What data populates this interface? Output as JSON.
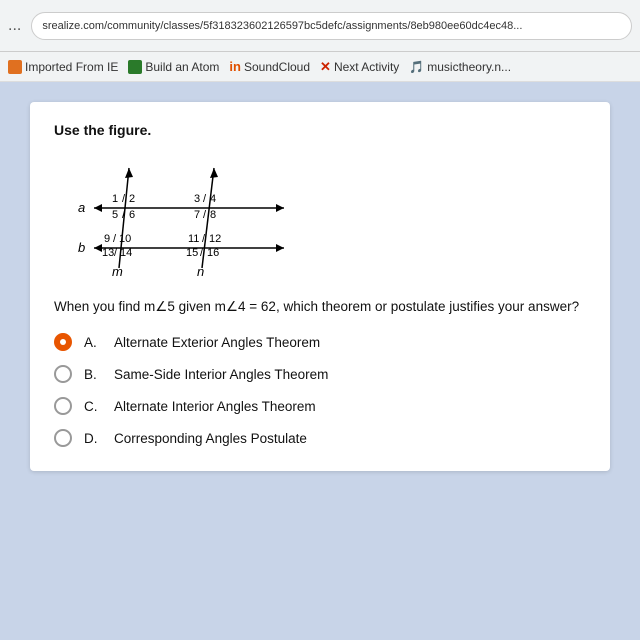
{
  "browser": {
    "url": "srealize.com/community/classes/5f318323602126597bc5defc/assignments/8eb980ee60dc4ec48...",
    "dots": "...",
    "bookmarks": [
      {
        "label": "Imported From IE",
        "icon": "orange-square"
      },
      {
        "label": "Build an Atom",
        "icon": "green-square"
      },
      {
        "label": "SoundCloud",
        "icon": "soundcloud"
      },
      {
        "label": "Next Activity",
        "icon": "x-red"
      },
      {
        "label": "musictheory.n...",
        "icon": "music"
      }
    ]
  },
  "card": {
    "figure_label": "Use the figure.",
    "question": "When you find m∠5 given m∠4 = 62, which theorem or postulate justifies your answer?",
    "options": [
      {
        "letter": "A.",
        "text": "Alternate Exterior Angles Theorem",
        "selected": true
      },
      {
        "letter": "B.",
        "text": "Same-Side Interior Angles Theorem",
        "selected": false
      },
      {
        "letter": "C.",
        "text": "Alternate Interior Angles Theorem",
        "selected": false
      },
      {
        "letter": "D.",
        "text": "Corresponding Angles Postulate",
        "selected": false
      }
    ]
  }
}
